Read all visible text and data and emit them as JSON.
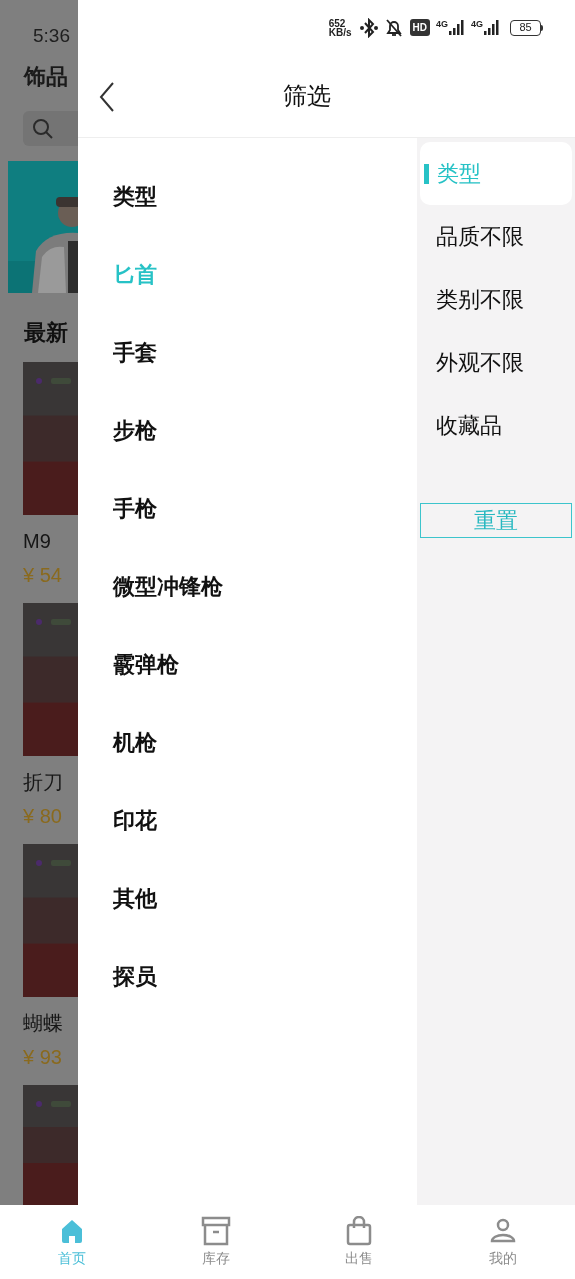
{
  "status_bar": {
    "time": "5:36",
    "net_speed_value": "652",
    "net_speed_unit": "KB/s",
    "hd": "HD",
    "signals": [
      "4G",
      "4G"
    ],
    "battery": "85"
  },
  "background_page": {
    "title": "饰品",
    "section": "最新",
    "items": [
      {
        "name": "M9",
        "price": "¥ 54"
      },
      {
        "name": "折刀",
        "price": "¥ 80"
      },
      {
        "name": "蝴蝶",
        "price": "¥ 93"
      }
    ]
  },
  "drawer": {
    "title": "筛选",
    "list_title": "类型",
    "options": [
      {
        "label": "匕首",
        "selected": true
      },
      {
        "label": "手套",
        "selected": false
      },
      {
        "label": "步枪",
        "selected": false
      },
      {
        "label": "手枪",
        "selected": false
      },
      {
        "label": "微型冲锋枪",
        "selected": false
      },
      {
        "label": "霰弹枪",
        "selected": false
      },
      {
        "label": "机枪",
        "selected": false
      },
      {
        "label": "印花",
        "selected": false
      },
      {
        "label": "其他",
        "selected": false
      },
      {
        "label": "探员",
        "selected": false
      }
    ],
    "side_tabs": [
      {
        "label": "类型",
        "selected": true
      },
      {
        "label": "品质不限",
        "selected": false
      },
      {
        "label": "类别不限",
        "selected": false
      },
      {
        "label": "外观不限",
        "selected": false
      },
      {
        "label": "收藏品",
        "selected": false
      }
    ],
    "reset_button": "重置"
  },
  "tab_bar": [
    {
      "kind": "home",
      "label": "首页",
      "selected": true
    },
    {
      "kind": "box",
      "label": "库存",
      "selected": false
    },
    {
      "kind": "bag",
      "label": "出售",
      "selected": false
    },
    {
      "kind": "user",
      "label": "我的",
      "selected": false
    }
  ]
}
